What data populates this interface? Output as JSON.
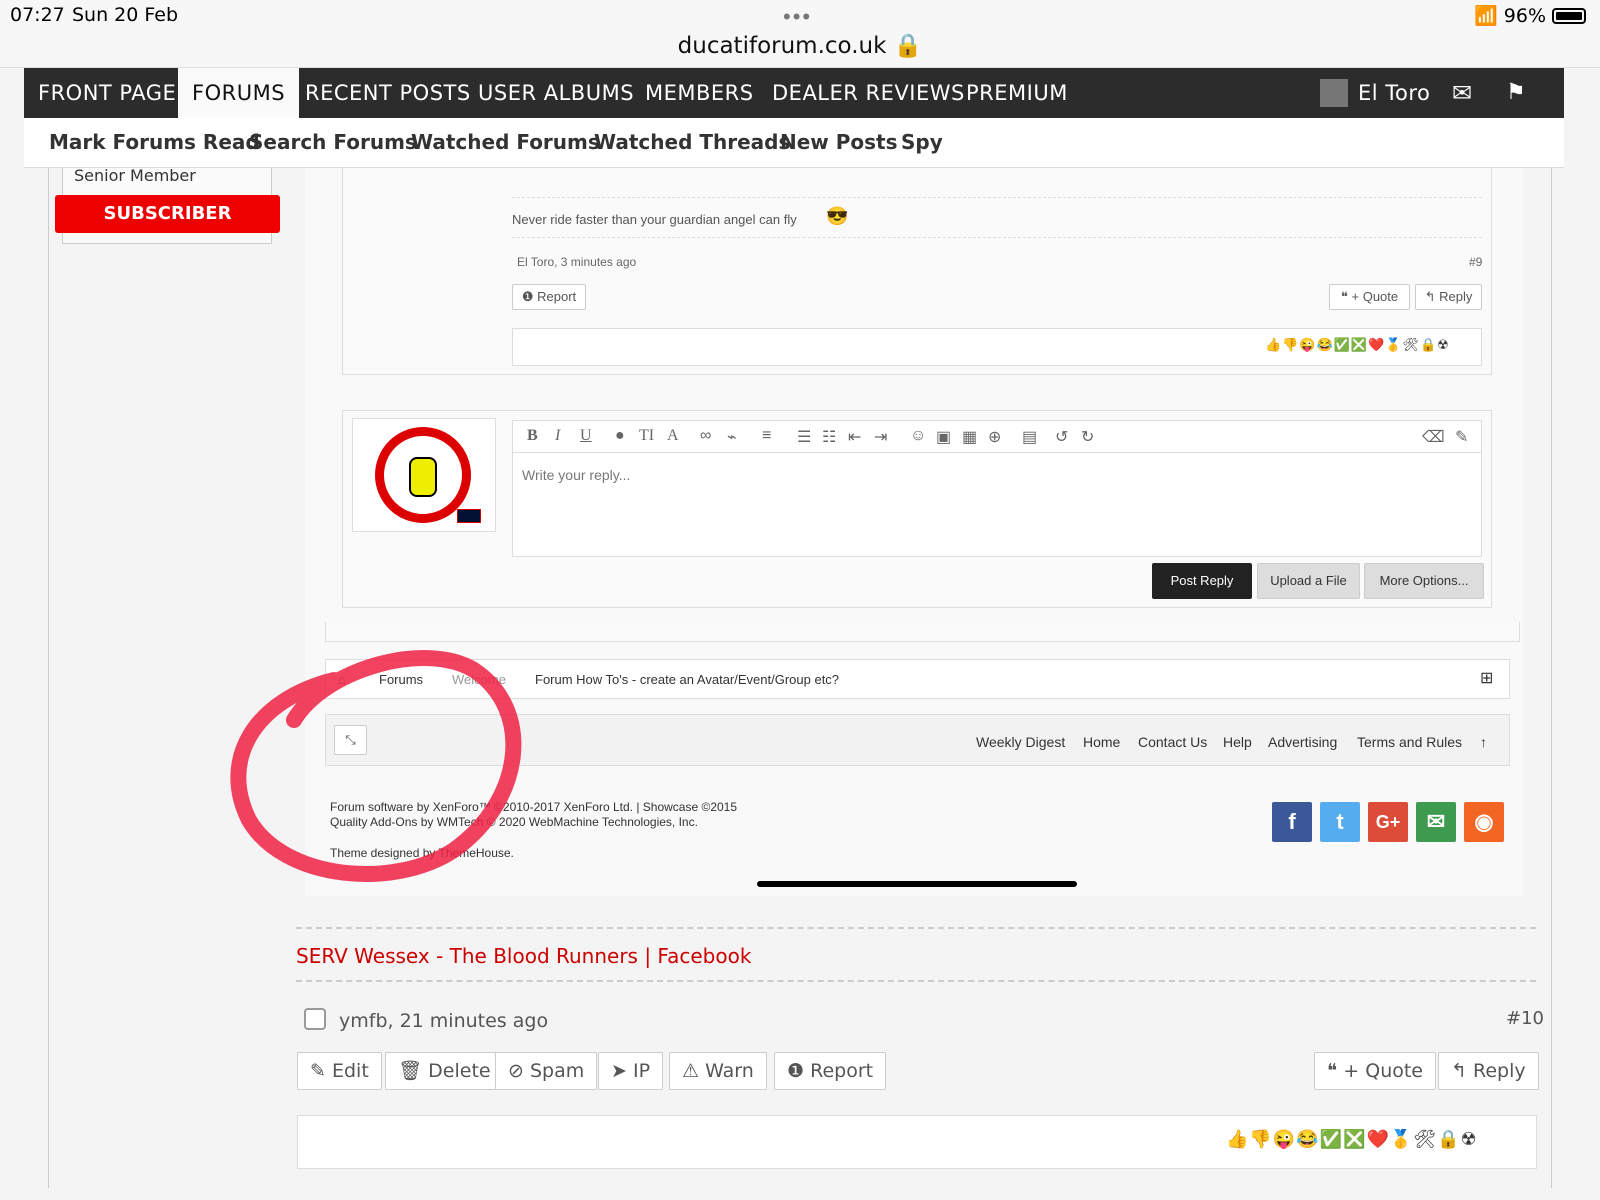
{
  "status": {
    "time": "07:27",
    "date": "Sun 20 Feb",
    "url": "ducatiforum.co.uk",
    "battery": "96%"
  },
  "nav": {
    "items": [
      "FRONT PAGE",
      "FORUMS",
      "RECENT POSTS",
      "USER ALBUMS",
      "MEMBERS",
      "DEALER REVIEWS",
      "PREMIUM"
    ],
    "user": "El Toro"
  },
  "subnav": [
    "Mark Forums Read",
    "Search Forums",
    "Watched Forums",
    "Watched Threads",
    "New Posts",
    "Spy"
  ],
  "sidebar": {
    "rank": "Senior Member",
    "badge": "SUBSCRIBER"
  },
  "inner": {
    "signature": "Never ride faster than your guardian angel can fly",
    "meta_author": "El Toro, 3 minutes ago",
    "meta_num": "#9",
    "report": "Report",
    "quote": "+ Quote",
    "reply": "Reply",
    "reply_placeholder": "Write your reply...",
    "post_reply": "Post Reply",
    "upload": "Upload a File",
    "more": "More Options...",
    "crumbs": [
      "Forums",
      "Welcome",
      "Forum How To's - create an Avatar/Event/Group etc?"
    ],
    "footer_links": [
      "Weekly Digest",
      "Home",
      "Contact Us",
      "Help",
      "Advertising",
      "Terms and Rules"
    ],
    "copyright1": "Forum software by XenForo™ ©2010-2017 XenForo Ltd. | Showcase ©2015",
    "copyright2": "Quality Add-Ons by WMTech © 2020 WebMachine Technologies, Inc.",
    "theme": "Theme designed by ThemeHouse."
  },
  "post": {
    "link": "SERV Wessex - The Blood Runners | Facebook",
    "author": "ymfb, 21 minutes ago",
    "num": "#10",
    "actions": [
      "Edit",
      "Delete",
      "Spam",
      "IP",
      "Warn",
      "Report"
    ],
    "quote": "+ Quote",
    "reply": "Reply"
  },
  "colors": {
    "nav": "#2c2c2c",
    "subscriber": "#e00000",
    "link": "#cc0000",
    "circle": "#ee2244"
  }
}
